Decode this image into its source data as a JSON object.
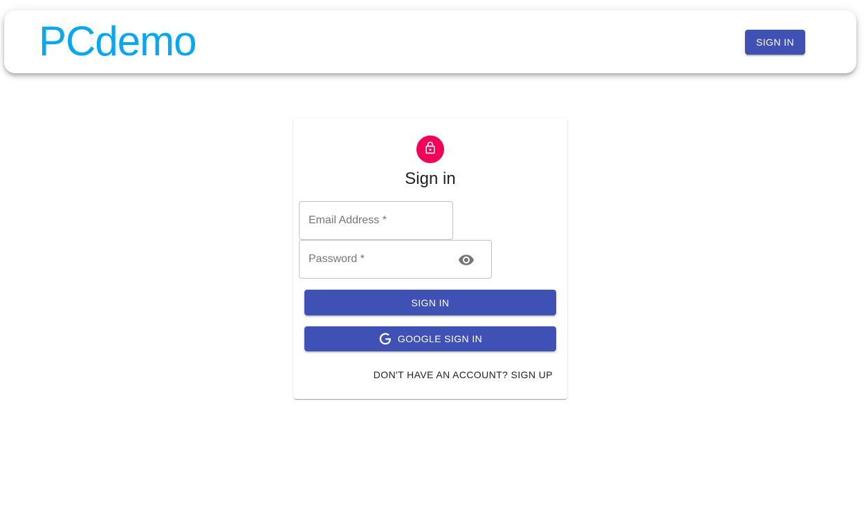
{
  "appbar": {
    "brand": "PCdemo",
    "signin_label": "SIGN IN"
  },
  "card": {
    "lock_icon": "lock-icon",
    "title": "Sign in",
    "email": {
      "placeholder": "Email Address *",
      "value": ""
    },
    "password": {
      "placeholder": "Password *",
      "value": "",
      "toggle_icon": "eye-icon"
    },
    "submit_label": "SIGN IN",
    "google_label": "GOOGLE SIGN IN",
    "google_icon": "google-icon",
    "signup_label": "DON'T HAVE AN ACCOUNT? SIGN UP"
  },
  "colors": {
    "primary": "#3f51b5",
    "brand": "#03a9f4",
    "avatar": "#f50057"
  }
}
